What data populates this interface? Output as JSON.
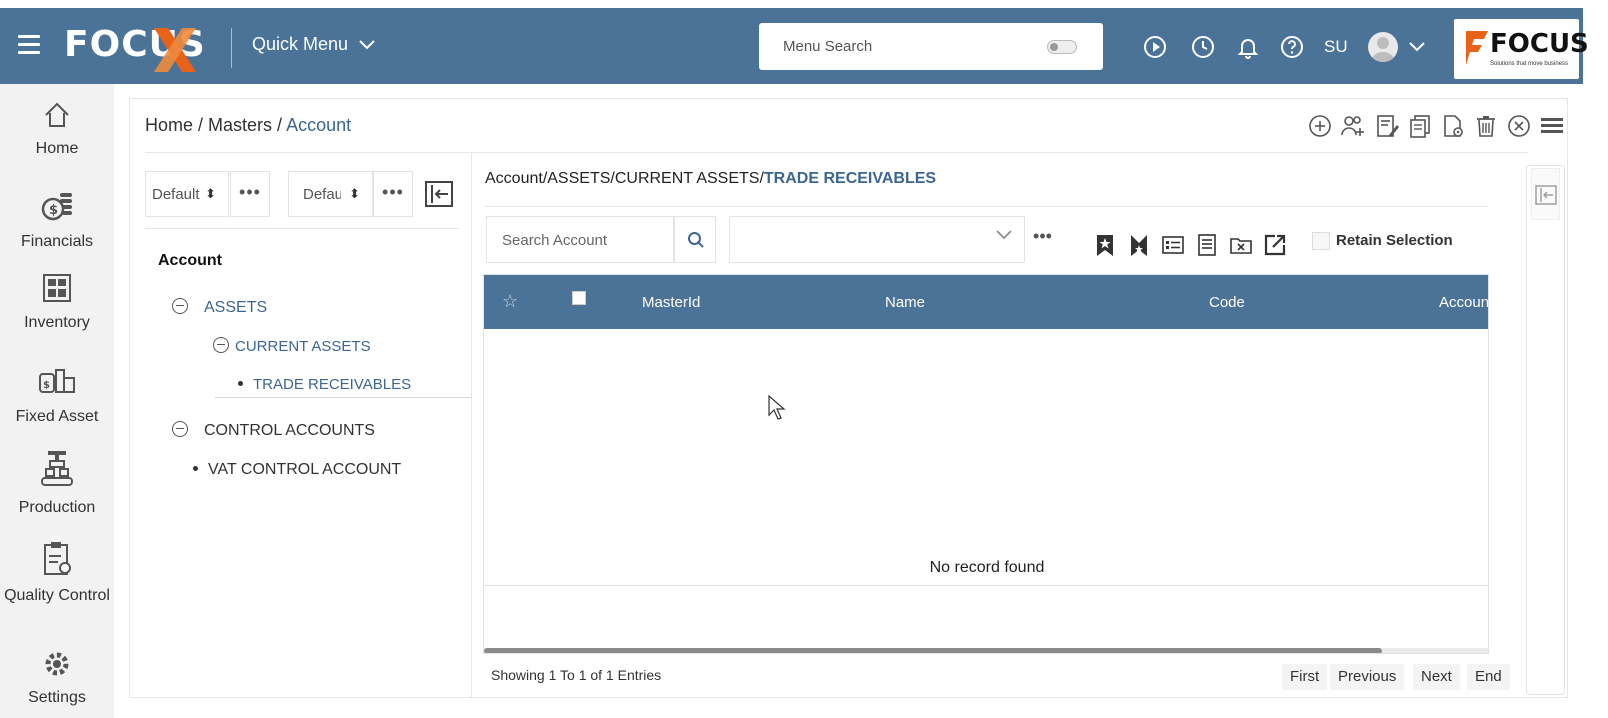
{
  "header": {
    "brand": "FOCUS",
    "quick_menu": "Quick Menu",
    "menu_search_placeholder": "Menu Search",
    "user_initials": "SU",
    "logo_text": "FOCUS",
    "logo_tagline": "Solutions that move business",
    "colors": {
      "bar": "#4b7398",
      "accent": "#e8621a"
    }
  },
  "sidebar": {
    "items": [
      {
        "label": "Home",
        "icon": "home-icon"
      },
      {
        "label": "Financials",
        "icon": "coins-icon"
      },
      {
        "label": "Inventory",
        "icon": "warehouse-icon"
      },
      {
        "label": "Fixed Asset",
        "icon": "fixed-asset-icon"
      },
      {
        "label": "Production",
        "icon": "conveyor-icon"
      },
      {
        "label": "Quality Control",
        "icon": "clipboard-icon"
      },
      {
        "label": "Settings",
        "icon": "gear-icon"
      }
    ]
  },
  "breadcrumb": {
    "home": "Home",
    "sep1": " / ",
    "masters": "Masters",
    "sep2": " / ",
    "current": "Account"
  },
  "tree_panel": {
    "view_select_1": "Default",
    "view_select_2": "Defau",
    "root": "Account",
    "nodes": [
      {
        "label": "ASSETS"
      },
      {
        "label": "CURRENT ASSETS"
      },
      {
        "label": "TRADE RECEIVABLES"
      },
      {
        "label": "CONTROL ACCOUNTS"
      },
      {
        "label": "VAT CONTROL ACCOUNT"
      }
    ]
  },
  "main": {
    "path_prefix": "Account/ASSETS/CURRENT ASSETS/",
    "path_current": "TRADE RECEIVABLES",
    "search_placeholder": "Search Account",
    "retain_selection": "Retain Selection",
    "columns": [
      "MasterId",
      "Name",
      "Code",
      "Account"
    ],
    "empty_message": "No record found",
    "showing": "Showing 1 To 1 of 1 Entries",
    "pager": {
      "first": "First",
      "previous": "Previous",
      "next": "Next",
      "end": "End"
    }
  }
}
